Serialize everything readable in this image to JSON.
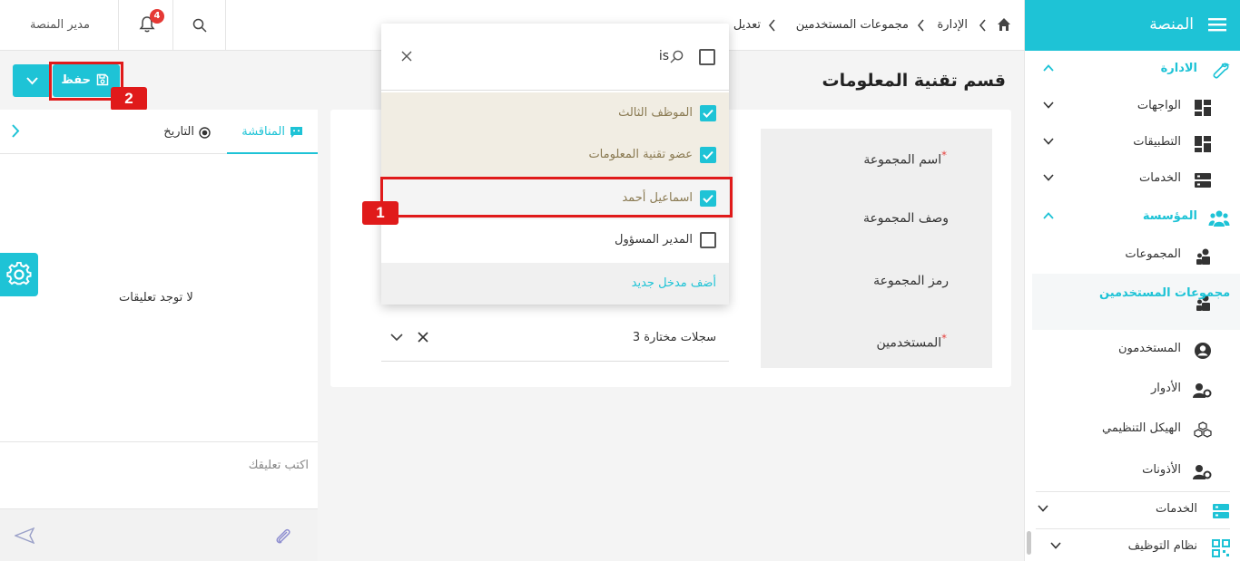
{
  "sidebar": {
    "title": "المنصة",
    "sections": {
      "administration": "الادارة",
      "organization": "المؤسسة"
    },
    "items": {
      "interfaces": "الواجهات",
      "applications": "التطبيقات",
      "services": "الخدمات",
      "groups": "المجموعات",
      "user_groups": "مجموعات المستخدمين",
      "users": "المستخدمون",
      "roles": "الأدوار",
      "org_structure": "الهيكل التنظيمي",
      "permissions": "الأذونات",
      "services_bottom": "الخدمات",
      "recruitment": "نظام التوظيف"
    }
  },
  "topbar": {
    "breadcrumb": [
      "الإدارة",
      "مجموعات المستخدمين",
      "تعديل"
    ],
    "user_name": "مدير المنصة",
    "notification_count": "4"
  },
  "page": {
    "title": "قسم تقنية المعلومات"
  },
  "form": {
    "labels": {
      "group_name": "اسم المجموعة",
      "group_description": "وصف المجموعة",
      "group_code": "رمز المجموعة",
      "users": "المستخدمين"
    },
    "required_mark": "*",
    "users_value": "3 سجلات مختارة"
  },
  "dropdown": {
    "search_text": "is",
    "options": [
      {
        "label": "الموظف الثالث",
        "checked": true
      },
      {
        "label": "عضو تقنية المعلومات",
        "checked": true
      },
      {
        "label": "اسماعيل أحمد",
        "checked": true
      },
      {
        "label": "المدير المسؤول",
        "checked": false
      }
    ],
    "add_new": "أضف مدخل جديد"
  },
  "toolbar": {
    "save_label": "حفظ"
  },
  "annotations": {
    "badge1": "1",
    "badge2": "2"
  },
  "left_panel": {
    "tabs": {
      "discussion": "المناقشة",
      "history": "التاريخ"
    },
    "empty_text": "لا توجد تعليقات",
    "comment_placeholder": "اكتب تعليقك"
  },
  "colors": {
    "accent": "#1ec3d6",
    "annotation": "#e01a1a",
    "badge": "#e53935"
  }
}
